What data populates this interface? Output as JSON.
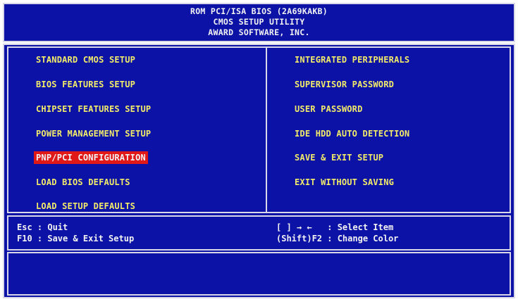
{
  "header": {
    "line1": "ROM PCI/ISA BIOS (2A69KAKB)",
    "line2": "CMOS SETUP UTILITY",
    "line3": "AWARD SOFTWARE, INC."
  },
  "menu": {
    "left": [
      {
        "label": "STANDARD CMOS SETUP"
      },
      {
        "label": "BIOS FEATURES SETUP"
      },
      {
        "label": "CHIPSET FEATURES SETUP"
      },
      {
        "label": "POWER MANAGEMENT SETUP"
      },
      {
        "label": "PNP/PCI CONFIGURATION"
      },
      {
        "label": "LOAD BIOS DEFAULTS"
      },
      {
        "label": "LOAD SETUP DEFAULTS"
      }
    ],
    "right": [
      {
        "label": "INTEGRATED PERIPHERALS"
      },
      {
        "label": "SUPERVISOR PASSWORD"
      },
      {
        "label": "USER PASSWORD"
      },
      {
        "label": "IDE HDD AUTO DETECTION"
      },
      {
        "label": "SAVE & EXIT SETUP"
      },
      {
        "label": "EXIT WITHOUT SAVING"
      }
    ],
    "selected": "PNP/PCI CONFIGURATION"
  },
  "help": {
    "esc": "Esc : Quit",
    "f10": "F10 : Save & Exit Setup",
    "select": "[ ] → ←   : Select Item",
    "color": "(Shift)F2 : Change Color"
  },
  "status": {
    "text": ""
  },
  "colors": {
    "background": "#0c12a6",
    "menu_text": "#f2eb6a",
    "highlight": "#e01818",
    "border": "#d8d8e8"
  }
}
